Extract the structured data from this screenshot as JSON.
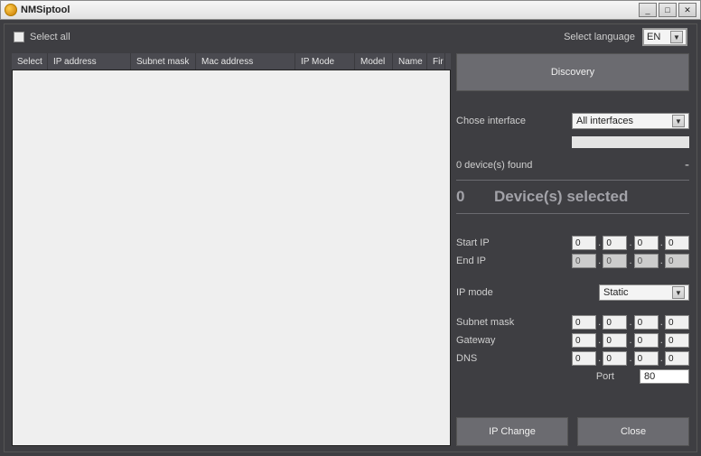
{
  "window": {
    "title": "NMSiptool"
  },
  "topstrip": {
    "select_all": "Select all",
    "select_language": "Select language",
    "language": "EN"
  },
  "table": {
    "columns": [
      "Select",
      "IP address",
      "Subnet mask",
      "Mac address",
      "IP Mode",
      "Model",
      "Name",
      "Fir"
    ],
    "widths": [
      40,
      92,
      72,
      110,
      66,
      42,
      38,
      20
    ]
  },
  "right": {
    "discovery": "Discovery",
    "chose_interface": "Chose interface",
    "interface_value": "All interfaces",
    "devices_found_prefix": "0 device(s) found",
    "selected_count": "0",
    "selected_label": "Device(s) selected",
    "start_ip_label": "Start IP",
    "end_ip_label": "End IP",
    "start_ip": [
      "0",
      "0",
      "0",
      "0"
    ],
    "end_ip": [
      "0",
      "0",
      "0",
      "0"
    ],
    "ip_mode_label": "IP mode",
    "ip_mode_value": "Static",
    "subnet_label": "Subnet mask",
    "gateway_label": "Gateway",
    "dns_label": "DNS",
    "subnet": [
      "0",
      "0",
      "0",
      "0"
    ],
    "gateway": [
      "0",
      "0",
      "0",
      "0"
    ],
    "dns": [
      "0",
      "0",
      "0",
      "0"
    ],
    "port_label": "Port",
    "port": "80",
    "ip_change": "IP Change",
    "close": "Close"
  }
}
